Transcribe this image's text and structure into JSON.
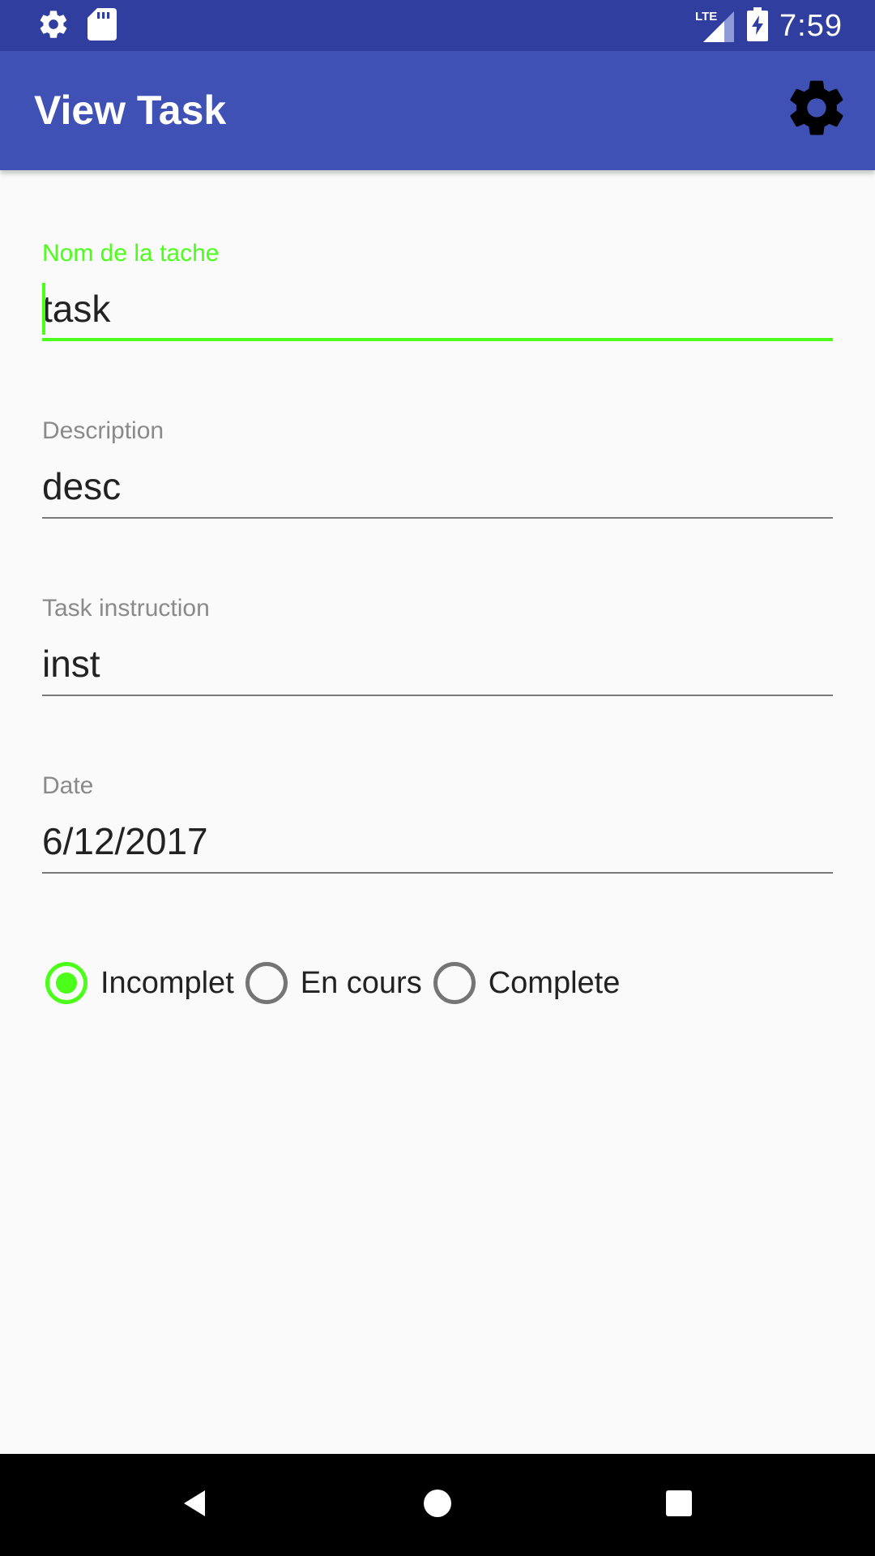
{
  "status_bar": {
    "time": "7:59",
    "left_icons": [
      "gear-icon",
      "sd-card-icon"
    ],
    "right_icons": [
      "lte-signal-icon",
      "battery-charging-icon"
    ],
    "network_label": "LTE"
  },
  "app_bar": {
    "title": "View Task",
    "settings_icon": "gear-icon"
  },
  "form": {
    "task_name": {
      "label": "Nom de la tache",
      "value": "task",
      "focused": true
    },
    "description": {
      "label": "Description",
      "value": "desc"
    },
    "instruction": {
      "label": "Task instruction",
      "value": "inst"
    },
    "date": {
      "label": "Date",
      "value": "6/12/2017"
    }
  },
  "status_options": {
    "selected": "Incomplet",
    "options": [
      "Incomplet",
      "En cours",
      "Complete"
    ]
  },
  "nav_bar": {
    "buttons": [
      "back-icon",
      "home-icon",
      "recents-icon"
    ]
  },
  "colors": {
    "status_bar": "#303f9f",
    "app_bar": "#3f51b5",
    "accent": "#4cff1a",
    "background": "#fafafa"
  }
}
